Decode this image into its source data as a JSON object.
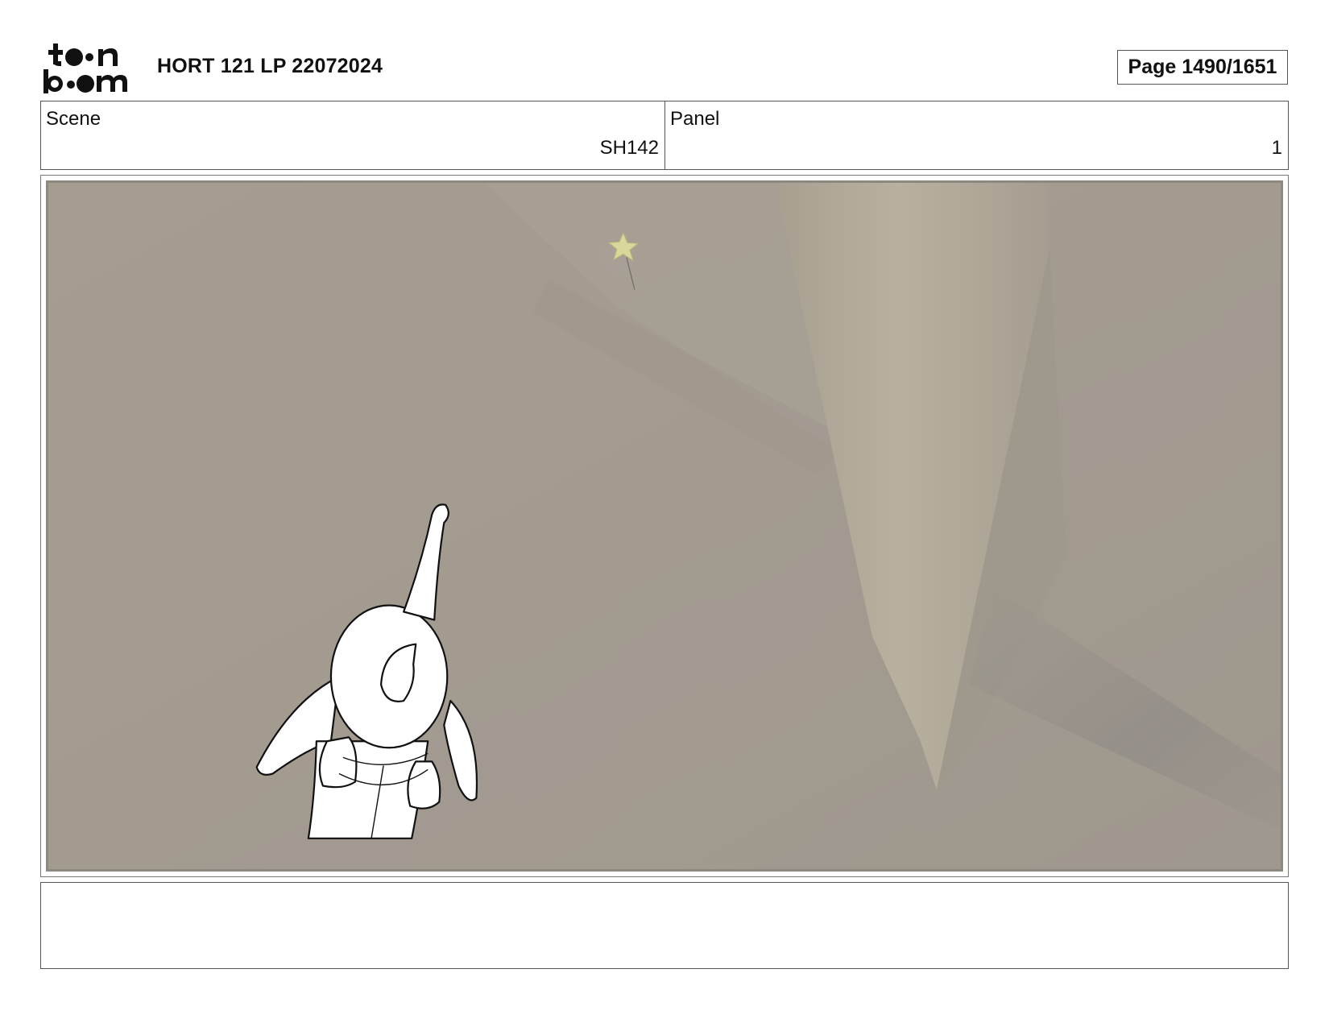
{
  "header": {
    "logo_text": "toon boom",
    "title": "HORT 121 LP 22072024",
    "page_label": "Page 1490/1651"
  },
  "info": {
    "scene_label": "Scene",
    "scene_value": "SH142",
    "panel_label": "Panel",
    "panel_value": "1"
  },
  "panel_image": {
    "description_icon": "storyboard-drawing",
    "background_color": "#a69e92",
    "accent_star_color": "#d9d89a"
  },
  "notes": {
    "text": ""
  }
}
